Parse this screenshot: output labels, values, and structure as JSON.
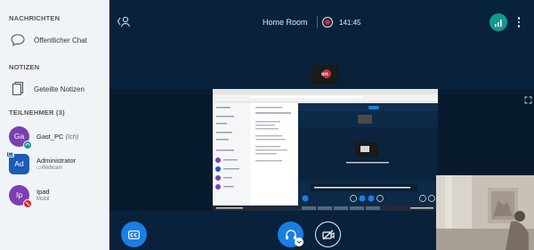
{
  "sidebar": {
    "messages_title": "NACHRICHTEN",
    "public_chat_label": "Öffentlicher Chat",
    "notes_title": "NOTIZEN",
    "shared_notes_label": "Geteilte Notizen",
    "participants_title": "TEILNEHMER (3)",
    "users": [
      {
        "initials": "Ga",
        "name": "Gast_PC",
        "suffix": "(Ich)",
        "subtitle": "",
        "color": "#7b3fb4",
        "status": "audio"
      },
      {
        "initials": "Ad",
        "name": "Administrator",
        "suffix": "",
        "subtitle": "Webcam",
        "color": "#1c5bb6",
        "status": "presenter"
      },
      {
        "initials": "Ip",
        "name": "Ipad",
        "suffix": "",
        "subtitle": "Mobil",
        "color": "#7b3fb4",
        "status": "muted"
      }
    ]
  },
  "header": {
    "room_title": "Home Room",
    "recording_time": "141:45"
  },
  "talker_label": "on",
  "icons": {
    "chat": "chat-bubble-icon",
    "notes": "notes-icon",
    "users_toggle": "users-icon",
    "connection": "signal-bars-icon",
    "more": "more-vertical-icon",
    "fullscreen": "fullscreen-icon",
    "captions": "closed-caption-icon",
    "audio": "headphones-icon",
    "video": "video-off-icon"
  },
  "colors": {
    "main_bg": "#08223c",
    "accent_blue": "#1c7ee3",
    "recording_red": "#e0242c",
    "connection_green": "#0f9b8e"
  }
}
